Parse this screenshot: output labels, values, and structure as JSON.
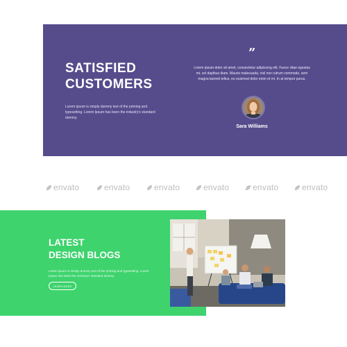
{
  "testimonials": {
    "title_line1": "SATISFIED",
    "title_line2": "CUSTOMERS",
    "description": "Lorem ipsum is simply dummy text of the priming and typesetting. Lorem Ipsum has been the industry's standard dummy.",
    "quote_mark": "”",
    "quote": "Lorem ipsum dolor sit amet, consectetur adipiscing elit. Fusce vitae egestas mi, vel dapibus diam. Mauris malesuada, nisl non rutrum commodo, sem magna laoreet tellus, eu euismod dolor enim et mi. In at tempor purus.",
    "author": "Sara Williams",
    "colors": {
      "panel": "#564c8c"
    }
  },
  "logos": [
    {
      "name": "leaf-icon",
      "text": "envato"
    },
    {
      "name": "leaf-icon",
      "text": "envato"
    },
    {
      "name": "leaf-icon",
      "text": "envato"
    },
    {
      "name": "leaf-icon",
      "text": "envato"
    },
    {
      "name": "leaf-icon",
      "text": "envato"
    },
    {
      "name": "leaf-icon",
      "text": "envato"
    }
  ],
  "blog": {
    "title_line1": "LATEST",
    "title_line2": "DESIGN BLOGS",
    "description": "Lorem ipsum is simply dummy text of the priming and typesetting. Lorem Ipsum has been the industry's standard dummy.",
    "button_label": "LEARN MORE",
    "colors": {
      "panel": "#3ed36d"
    }
  }
}
